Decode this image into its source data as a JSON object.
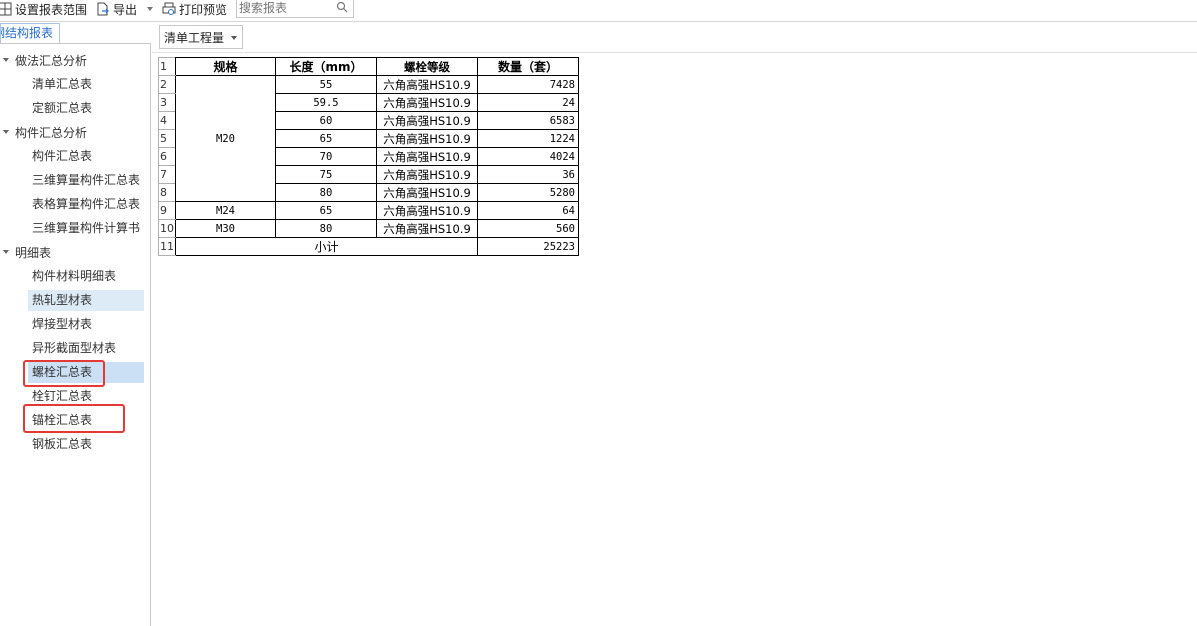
{
  "toolbar": {
    "set_range_label": "设置报表范围",
    "export_label": "导出",
    "print_preview_label": "打印预览",
    "search_placeholder": "搜索报表"
  },
  "left_tab": {
    "label": "钢结构报表"
  },
  "tree": {
    "groups": [
      {
        "label": "做法汇总分析",
        "items": [
          "清单汇总表",
          "定额汇总表"
        ]
      },
      {
        "label": "构件汇总分析",
        "items": [
          "构件汇总表",
          "三维算量构件汇总表",
          "表格算量构件汇总表",
          "三维算量构件计算书"
        ]
      },
      {
        "label": "明细表",
        "items": [
          "构件材料明细表",
          "热轧型材表",
          "焊接型材表",
          "异形截面型材表",
          "螺栓汇总表",
          "栓钉汇总表",
          "锚栓汇总表",
          "钢板汇总表"
        ]
      }
    ],
    "selected_item": "螺栓汇总表",
    "highlighted_item": "热轧型材表",
    "annotated_items": [
      "螺栓汇总表",
      "锚栓汇总表"
    ]
  },
  "view_selector": {
    "value": "清单工程量"
  },
  "report": {
    "headers": [
      "规格",
      "长度（mm）",
      "螺栓等级",
      "数量（套）"
    ],
    "row_numbers": [
      "1",
      "2",
      "3",
      "4",
      "5",
      "6",
      "7",
      "8",
      "9",
      "10",
      "11"
    ],
    "groups": [
      {
        "spec": "M20",
        "rows": [
          {
            "length": "55",
            "grade": "六角高强HS10.9",
            "qty": "7428"
          },
          {
            "length": "59.5",
            "grade": "六角高强HS10.9",
            "qty": "24"
          },
          {
            "length": "60",
            "grade": "六角高强HS10.9",
            "qty": "6583"
          },
          {
            "length": "65",
            "grade": "六角高强HS10.9",
            "qty": "1224"
          },
          {
            "length": "70",
            "grade": "六角高强HS10.9",
            "qty": "4024"
          },
          {
            "length": "75",
            "grade": "六角高强HS10.9",
            "qty": "36"
          },
          {
            "length": "80",
            "grade": "六角高强HS10.9",
            "qty": "5280"
          }
        ]
      },
      {
        "spec": "M24",
        "rows": [
          {
            "length": "65",
            "grade": "六角高强HS10.9",
            "qty": "64"
          }
        ]
      },
      {
        "spec": "M30",
        "rows": [
          {
            "length": "80",
            "grade": "六角高强HS10.9",
            "qty": "560"
          }
        ]
      }
    ],
    "subtotal_label": "小计",
    "subtotal_value": "25223"
  },
  "colors": {
    "accent": "#2a6fc9",
    "selection": "#cce0f5",
    "annotation": "#e53935"
  }
}
